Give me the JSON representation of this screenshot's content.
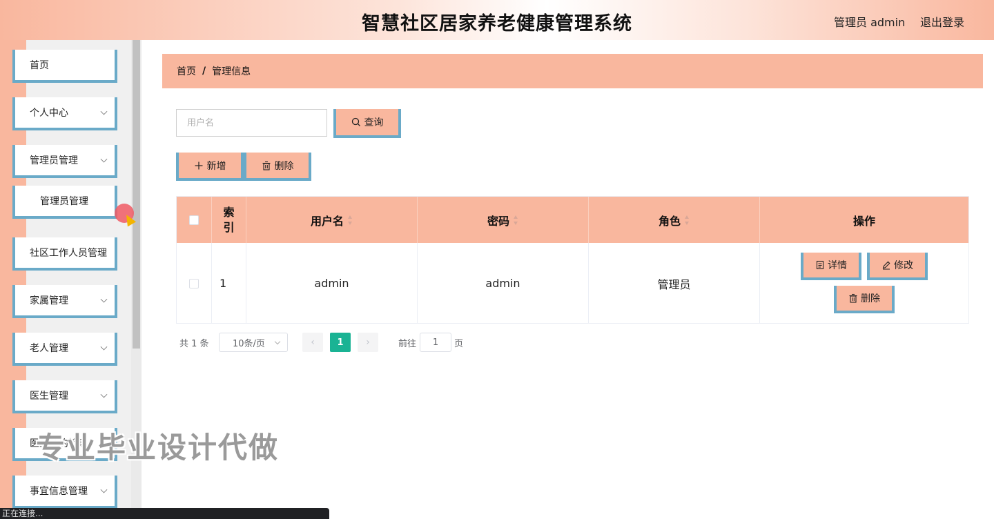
{
  "header": {
    "title": "智慧社区居家养老健康管理系统",
    "user": "管理员 admin",
    "logout": "退出登录"
  },
  "sidebar": {
    "items": [
      {
        "label": "首页",
        "has_arrow": false
      },
      {
        "label": "个人中心",
        "has_arrow": true
      },
      {
        "label": "管理员管理",
        "has_arrow": true
      },
      {
        "label": "管理员管理",
        "has_arrow": false,
        "sub": true
      },
      {
        "label": "社区工作人员管理",
        "has_arrow": false
      },
      {
        "label": "家属管理",
        "has_arrow": true
      },
      {
        "label": "老人管理",
        "has_arrow": true
      },
      {
        "label": "医生管理",
        "has_arrow": true
      },
      {
        "label": "医生预约管理",
        "has_arrow": false
      },
      {
        "label": "事宜信息管理",
        "has_arrow": true
      }
    ]
  },
  "breadcrumb": {
    "home": "首页",
    "separator": "/",
    "current": "管理信息"
  },
  "search": {
    "placeholder": "用户名",
    "value": "",
    "button": "查询"
  },
  "actions": {
    "add": "新增",
    "delete": "删除"
  },
  "table": {
    "headers": {
      "index": "索引",
      "username": "用户名",
      "password": "密码",
      "role": "角色",
      "operation": "操作"
    },
    "rows": [
      {
        "index": "1",
        "username": "admin",
        "password": "admin",
        "role": "管理员"
      }
    ],
    "row_buttons": {
      "detail": "详情",
      "edit": "修改",
      "delete": "删除"
    }
  },
  "pagination": {
    "total": "共 1 条",
    "page_size": "10条/页",
    "prev": "‹",
    "current_page": "1",
    "next": "›",
    "goto_label": "前往",
    "goto_value": "1",
    "goto_suffix": "页"
  },
  "overlay": {
    "watermark": "专业毕业设计代做",
    "status": "正在连接..."
  },
  "colors": {
    "accent": "#f9b79e",
    "border_accent": "#6aaac8",
    "current_page": "#1ab394"
  }
}
